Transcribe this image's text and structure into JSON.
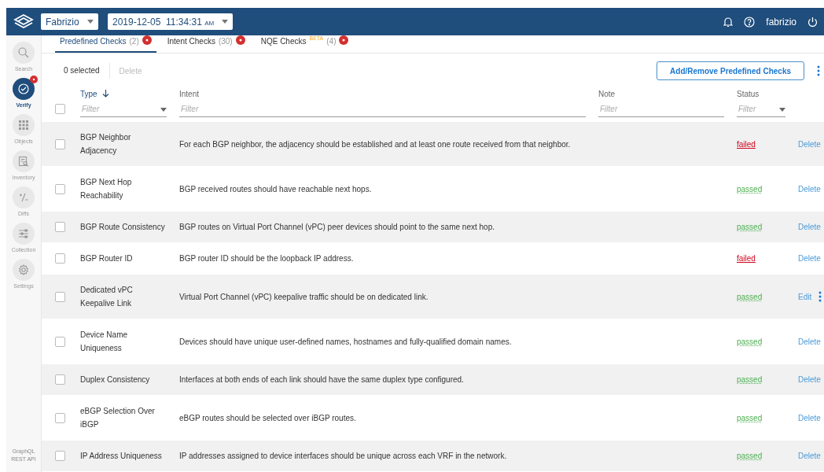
{
  "header": {
    "network": "Fabrizio",
    "snapshot": {
      "date": "2019-12-05",
      "time": "11:34:31",
      "meridiem": "AM"
    },
    "user": "fabrizio"
  },
  "sidebar": {
    "items": [
      {
        "label": "Search",
        "selected": false,
        "alert": false
      },
      {
        "label": "Verify",
        "selected": true,
        "alert": true
      },
      {
        "label": "Objects",
        "selected": false,
        "alert": false
      },
      {
        "label": "Inventory",
        "selected": false,
        "alert": false
      },
      {
        "label": "Diffs",
        "selected": false,
        "alert": false
      },
      {
        "label": "Collection",
        "selected": false,
        "alert": false
      },
      {
        "label": "Settings",
        "selected": false,
        "alert": false
      }
    ],
    "links": [
      "GraphQL",
      "REST API"
    ]
  },
  "tabs": [
    {
      "label": "Predefined Checks",
      "count": "(2)",
      "selected": true,
      "alert": true
    },
    {
      "label": "Intent Checks",
      "count": "(30)",
      "selected": false,
      "alert": true
    },
    {
      "label": "NQE Checks",
      "tag": "BETA",
      "count": "(4)",
      "selected": false,
      "alert": true
    }
  ],
  "toolbar": {
    "selection": "0 selected",
    "delete": "Delete",
    "button": "Add/Remove Predefined Checks"
  },
  "table": {
    "all_checked": false,
    "columns": [
      {
        "title": "Type",
        "sorted": true,
        "filter": "Filter",
        "dropdown": true
      },
      {
        "title": "Intent",
        "sorted": false,
        "filter": "Filter",
        "dropdown": false
      },
      {
        "title": "Note",
        "sorted": false,
        "filter": "Filter",
        "dropdown": false
      },
      {
        "title": "Status",
        "sorted": false,
        "filter": "Filter",
        "dropdown": true
      }
    ],
    "rows": [
      {
        "checked": false,
        "type": "BGP Neighbor Adjacency",
        "intent": "For each BGP neighbor, the adjacency should be established and at least one route received from that neighbor.",
        "status": "failed",
        "failed": true,
        "action": "Delete",
        "kind": "delete"
      },
      {
        "checked": false,
        "type": "BGP Next Hop Reachability",
        "intent": "BGP received routes should have reachable next hops.",
        "status": "passed",
        "failed": false,
        "action": "Delete",
        "kind": "delete"
      },
      {
        "checked": false,
        "type": "BGP Route Consistency",
        "intent": "BGP routes on Virtual Port Channel (vPC) peer devices should point to the same next hop.",
        "status": "passed",
        "failed": false,
        "action": "Delete",
        "kind": "delete"
      },
      {
        "checked": false,
        "type": "BGP Router ID",
        "intent": "BGP router ID should be the loopback IP address.",
        "status": "failed",
        "failed": true,
        "action": "Delete",
        "kind": "delete"
      },
      {
        "checked": false,
        "type": "Dedicated vPC Keepalive Link",
        "intent": "Virtual Port Channel (vPC) keepalive traffic should be on dedicated link.",
        "status": "passed",
        "failed": false,
        "action": "Edit",
        "kind": "edit"
      },
      {
        "checked": false,
        "type": "Device Name Uniqueness",
        "intent": "Devices should have unique user-defined names, hostnames and fully-qualified domain names.",
        "status": "passed",
        "failed": false,
        "action": "Delete",
        "kind": "delete"
      },
      {
        "checked": false,
        "type": "Duplex Consistency",
        "intent": "Interfaces at both ends of each link should have the same duplex type configured.",
        "status": "passed",
        "failed": false,
        "action": "Delete",
        "kind": "delete"
      },
      {
        "checked": false,
        "type": "eBGP Selection Over iBGP",
        "intent": "eBGP routes should be selected over iBGP routes.",
        "status": "passed",
        "failed": false,
        "action": "Delete",
        "kind": "delete"
      },
      {
        "checked": false,
        "type": "IP Address Uniqueness",
        "intent": "IP addresses assigned to device interfaces should be unique across each VRF in the network.",
        "status": "passed",
        "failed": false,
        "action": "Delete",
        "kind": "delete"
      }
    ]
  }
}
